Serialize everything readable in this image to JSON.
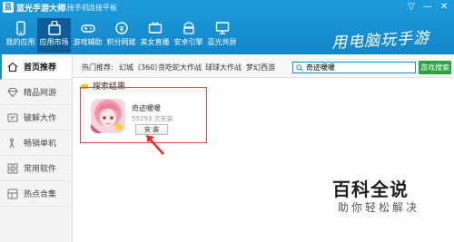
{
  "app": {
    "title": "蓝光手游大师",
    "logo": "蓝"
  },
  "titlebar": {
    "login_phone": "连接手机",
    "login_pad": "连接平板",
    "window_buttons": [
      "▽",
      "—",
      "✕"
    ]
  },
  "nav": {
    "tabs": [
      {
        "label": "我的应用",
        "icon": "phone-icon"
      },
      {
        "label": "应用市场",
        "icon": "store-bag-icon",
        "active": true
      },
      {
        "label": "游戏辅助",
        "icon": "gamepad-icon"
      },
      {
        "label": "积分网赋",
        "icon": "coin-icon"
      },
      {
        "label": "美女直播",
        "icon": "tv-icon"
      },
      {
        "label": "安卓引擎",
        "icon": "android-icon"
      },
      {
        "label": "蓝光共屏",
        "icon": "screen-icon"
      }
    ],
    "slogan": "用电脑玩手游"
  },
  "sidebar": {
    "items": [
      {
        "label": "首页推荐",
        "icon": "home-icon",
        "active": true
      },
      {
        "label": "精品网游",
        "icon": "diamond-icon"
      },
      {
        "label": "破解大作",
        "icon": "wrench-icon"
      },
      {
        "label": "畅销单机",
        "icon": "joystick-icon"
      },
      {
        "label": "常用软件",
        "icon": "grid-icon"
      },
      {
        "label": "热点合集",
        "icon": "collection-icon"
      }
    ]
  },
  "hotbar": {
    "label": "热门推荐:",
    "items": [
      "幻城（360）",
      "贪吃蛇大作战",
      "球球大作战",
      "梦幻西游"
    ]
  },
  "search": {
    "value": "奇迹暖暖",
    "button": "游戏搜索"
  },
  "results": {
    "heading": "搜索结果",
    "items": [
      {
        "name": "奇迹暖暖",
        "installs": "55293 次安装",
        "button": "安 装"
      }
    ]
  },
  "watermark": {
    "main": "百科全说",
    "sub": "助你轻松解决"
  },
  "colors": {
    "header": "#1a8dd3",
    "active_tab": "#0d5e98",
    "search_button": "#2aa33e",
    "highlight": "#e84a4a"
  }
}
